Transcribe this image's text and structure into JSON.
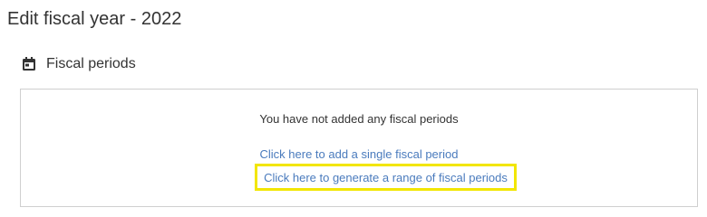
{
  "page": {
    "title": "Edit fiscal year - 2022"
  },
  "section": {
    "title": "Fiscal periods",
    "icon": "calendar-icon"
  },
  "panel": {
    "empty_message": "You have not added any fiscal periods",
    "add_single_link": "Click here to add a single fiscal period",
    "generate_range_link": "Click here to generate a range of fiscal periods"
  },
  "colors": {
    "link": "#4a7bbd",
    "highlight": "#f2e600",
    "text": "#333333",
    "border": "#cfcfcf"
  }
}
